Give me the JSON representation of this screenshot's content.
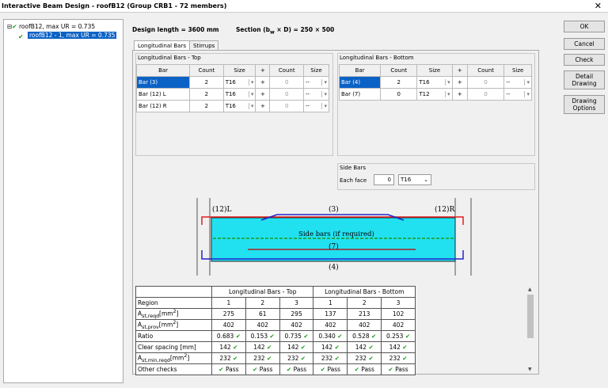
{
  "window": {
    "title": "Interactive Beam Design - roofB12 (Group CRB1 - 72 members)",
    "close": "✕"
  },
  "tree": {
    "root": "roofB12, max UR = 0.735",
    "child": "roofB12 - 1, max UR = 0.735"
  },
  "buttons": [
    "OK",
    "Cancel",
    "Check",
    "Detail Drawing",
    "Drawing Options"
  ],
  "header": {
    "design_length": "Design length = 3600 mm",
    "section": "Section (b",
    "section_sub": "w",
    "section_rest": " × D) = 250 × 500"
  },
  "tabs": [
    "Longitudinal Bars",
    "Stirrups"
  ],
  "top": {
    "title": "Longitudinal Bars - Top",
    "cols": [
      "Bar",
      "Count",
      "Size",
      "+",
      "Count",
      "Size"
    ],
    "rows": [
      [
        "Bar (3)",
        "2",
        "T16",
        "+",
        "0",
        "--"
      ],
      [
        "Bar (12) L",
        "2",
        "T16",
        "+",
        "0",
        "--"
      ],
      [
        "Bar (12) R",
        "2",
        "T16",
        "+",
        "0",
        "--"
      ]
    ]
  },
  "bottom": {
    "title": "Longitudinal Bars - Bottom",
    "cols": [
      "Bar",
      "Count",
      "Size",
      "+",
      "Count",
      "Size"
    ],
    "rows": [
      [
        "Bar (4)",
        "2",
        "T16",
        "+",
        "0",
        "--"
      ],
      [
        "Bar (7)",
        "0",
        "T12",
        "+",
        "0",
        "--"
      ]
    ]
  },
  "side": {
    "title": "Side Bars",
    "label": "Each face",
    "count": "0",
    "size": "T16"
  },
  "diagram": {
    "l12": "(12)L",
    "r12": "(12)R",
    "b3": "(3)",
    "side": "Side bars (if required)",
    "b7": "(7)",
    "b4": "(4)"
  },
  "results": {
    "head1": "Longitudinal Bars - Top",
    "head2": "Longitudinal Bars - Bottom",
    "region": [
      "Region",
      "1",
      "2",
      "3",
      "1",
      "2",
      "3"
    ],
    "ast_req": [
      "275",
      "61",
      "295",
      "137",
      "213",
      "102"
    ],
    "ast_prov": [
      "402",
      "402",
      "402",
      "402",
      "402",
      "402"
    ],
    "ratio": [
      "0.683",
      "0.153",
      "0.735",
      "0.340",
      "0.528",
      "0.253"
    ],
    "ratio_label": "Ratio",
    "clear": [
      "142",
      "142",
      "142",
      "142",
      "142",
      "142"
    ],
    "clear_label": "Clear spacing [mm]",
    "astmin": [
      "232",
      "232",
      "232",
      "232",
      "232",
      "232"
    ],
    "other": [
      "Pass",
      "Pass",
      "Pass",
      "Pass",
      "Pass",
      "Pass"
    ],
    "other_label": "Other checks"
  }
}
